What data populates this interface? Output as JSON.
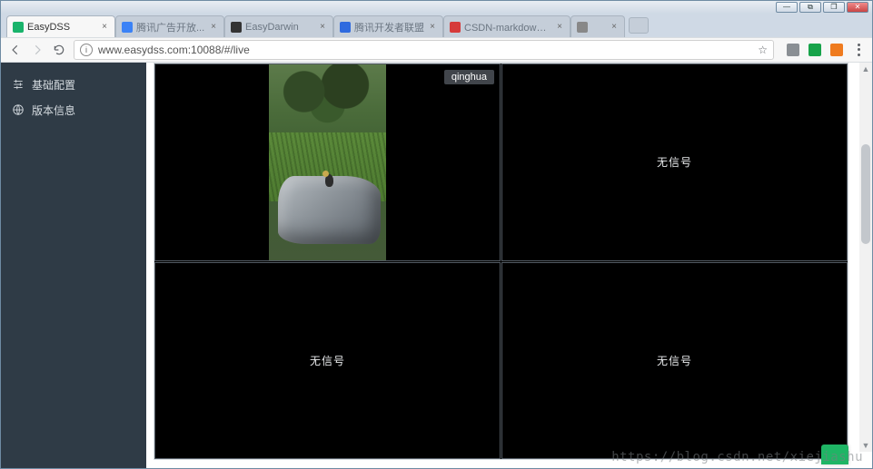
{
  "window": {
    "minimize_glyph": "—",
    "maximize_glyph": "❐",
    "restore_glyph": "⧉",
    "close_glyph": "✕"
  },
  "tabs": [
    {
      "title": "EasyDSS",
      "active": true,
      "faviconColor": "#19b36b"
    },
    {
      "title": "腾讯广告开放...",
      "active": false,
      "faviconColor": "#3b82f6"
    },
    {
      "title": "EasyDarwin",
      "active": false,
      "faviconColor": "#333333"
    },
    {
      "title": "腾讯开发者联盟",
      "active": false,
      "faviconColor": "#2f6adf"
    },
    {
      "title": "CSDN-markdown编辑...",
      "active": false,
      "faviconColor": "#d63a3a"
    },
    {
      "title": "",
      "active": false,
      "faviconColor": "#888888"
    }
  ],
  "toolbar": {
    "url": "www.easydss.com:10088/#/live",
    "star_glyph": "☆"
  },
  "extensions": [
    {
      "name": "ext-1",
      "color": "#8a8f94"
    },
    {
      "name": "ext-shield",
      "color": "#17a34a"
    },
    {
      "name": "ext-orange",
      "color": "#ef7b1f"
    }
  ],
  "sidebar": {
    "items": [
      {
        "id": "basic-config",
        "label": "基础配置"
      },
      {
        "id": "version-info",
        "label": "版本信息"
      }
    ]
  },
  "grid": {
    "cells": [
      {
        "type": "stream",
        "badge": "qinghua"
      },
      {
        "type": "empty",
        "text": "无信号"
      },
      {
        "type": "empty",
        "text": "无信号"
      },
      {
        "type": "empty",
        "text": "无信号"
      }
    ]
  },
  "watermark": "https://blog.csdn.net/xiejiashu"
}
